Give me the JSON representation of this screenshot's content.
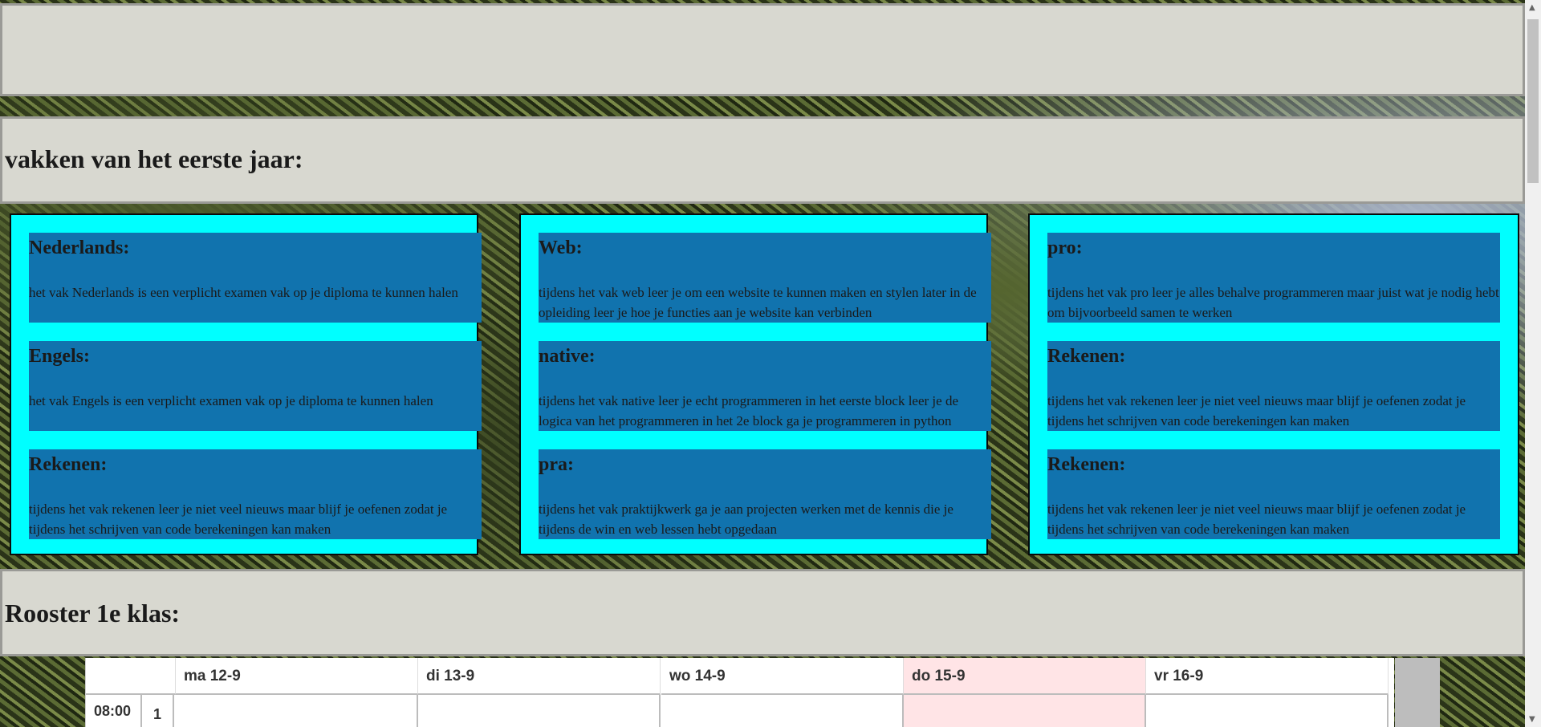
{
  "section_headers": {
    "subjects": "vakken van het eerste jaar:",
    "schedule": "Rooster 1e klas:"
  },
  "columns": [
    {
      "cards": [
        {
          "title": "Nederlands:",
          "text": "het vak Nederlands is een verplicht examen vak op je diploma te kunnen halen"
        },
        {
          "title": "Engels:",
          "text": "het vak Engels is een verplicht examen vak op je diploma te kunnen halen"
        },
        {
          "title": "Rekenen:",
          "text": "tijdens het vak rekenen leer je niet veel nieuws maar blijf je oefenen zodat je tijdens het schrijven van code berekeningen kan maken"
        }
      ]
    },
    {
      "cards": [
        {
          "title": "Web:",
          "text": "tijdens het vak web leer je om een website te kunnen maken en stylen later in de opleiding leer je hoe je functies aan je website kan verbinden"
        },
        {
          "title": "native:",
          "text": "tijdens het vak native leer je echt programmeren in het eerste block leer je de logica van het programmeren in het 2e block ga je programmeren in python"
        },
        {
          "title": "pra:",
          "text": "tijdens het vak praktijkwerk ga je aan projecten werken met de kennis die je tijdens de win en web lessen hebt opgedaan"
        }
      ]
    },
    {
      "cards": [
        {
          "title": "pro:",
          "text": "tijdens het vak pro leer je alles behalve programmeren maar juist wat je nodig hebt om bijvoorbeeld samen te werken"
        },
        {
          "title": "Rekenen:",
          "text": "tijdens het vak rekenen leer je niet veel nieuws maar blijf je oefenen zodat je tijdens het schrijven van code berekeningen kan maken"
        },
        {
          "title": "Rekenen:",
          "text": "tijdens het vak rekenen leer je niet veel nieuws maar blijf je oefenen zodat je tijdens het schrijven van code berekeningen kan maken"
        }
      ]
    }
  ],
  "timetable": {
    "days": [
      "ma 12-9",
      "di 13-9",
      "wo 14-9",
      "do 15-9",
      "vr 16-9"
    ],
    "highlight_color": "#ffe4e6",
    "first_row": {
      "time": "08:00",
      "period": "1"
    }
  },
  "colors": {
    "banner": "#d8d8d0",
    "column_bg": "#00ffff",
    "card_bg": "#1173ae"
  }
}
